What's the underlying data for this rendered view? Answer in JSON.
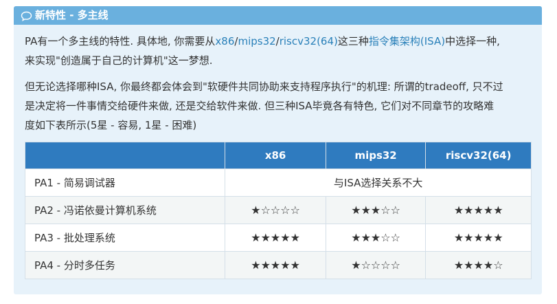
{
  "callout": {
    "title": "新特性 - 多主线",
    "icon": "speech-bubble-icon"
  },
  "paragraph1": {
    "t1": "PA有一个多主线的特性. 具体地, 你需要从",
    "link_x86": "x86",
    "sep1": "/",
    "link_mips32": "mips32",
    "sep2": "/",
    "link_riscv": "riscv32(64)",
    "t2": "这三种",
    "link_isa": "指令集架构(ISA)",
    "t3": "中选择一种,",
    "t4": "来实现\"创造属于自己的计算机\"这一梦想."
  },
  "paragraph2": {
    "line1": "但无论选择哪种ISA, 你最终都会体会到\"软硬件共同协助来支持程序执行\"的机理: 所谓的tradeoff, 只不过",
    "line2": "是决定将一件事情交给硬件来做, 还是交给软件来做. 但三种ISA毕竟各有特色, 它们对不同章节的攻略难",
    "line3": "度如下表所示(5星 - 容易, 1星 - 困难)"
  },
  "table": {
    "headers": [
      "",
      "x86",
      "mips32",
      "riscv32(64)"
    ],
    "row1": {
      "name": "PA1 - 简易调试器",
      "merged": "与ISA选择关系不大"
    },
    "row2": {
      "name": "PA2 - 冯诺依曼计算机系统",
      "x86": "★☆☆☆☆",
      "mips32": "★★★☆☆",
      "riscv": "★★★★★"
    },
    "row3": {
      "name": "PA3 - 批处理系统",
      "x86": "★★★★★",
      "mips32": "★★★☆☆",
      "riscv": "★★★★★"
    },
    "row4": {
      "name": "PA4 - 分时多任务",
      "x86": "★★★★★",
      "mips32": "★☆☆☆☆",
      "riscv": "★★★★☆"
    }
  },
  "colors": {
    "header_bg": "#6ab0de",
    "body_bg": "#e7f2fa",
    "table_header_bg": "#2f7bbf",
    "link": "#2980b9"
  }
}
